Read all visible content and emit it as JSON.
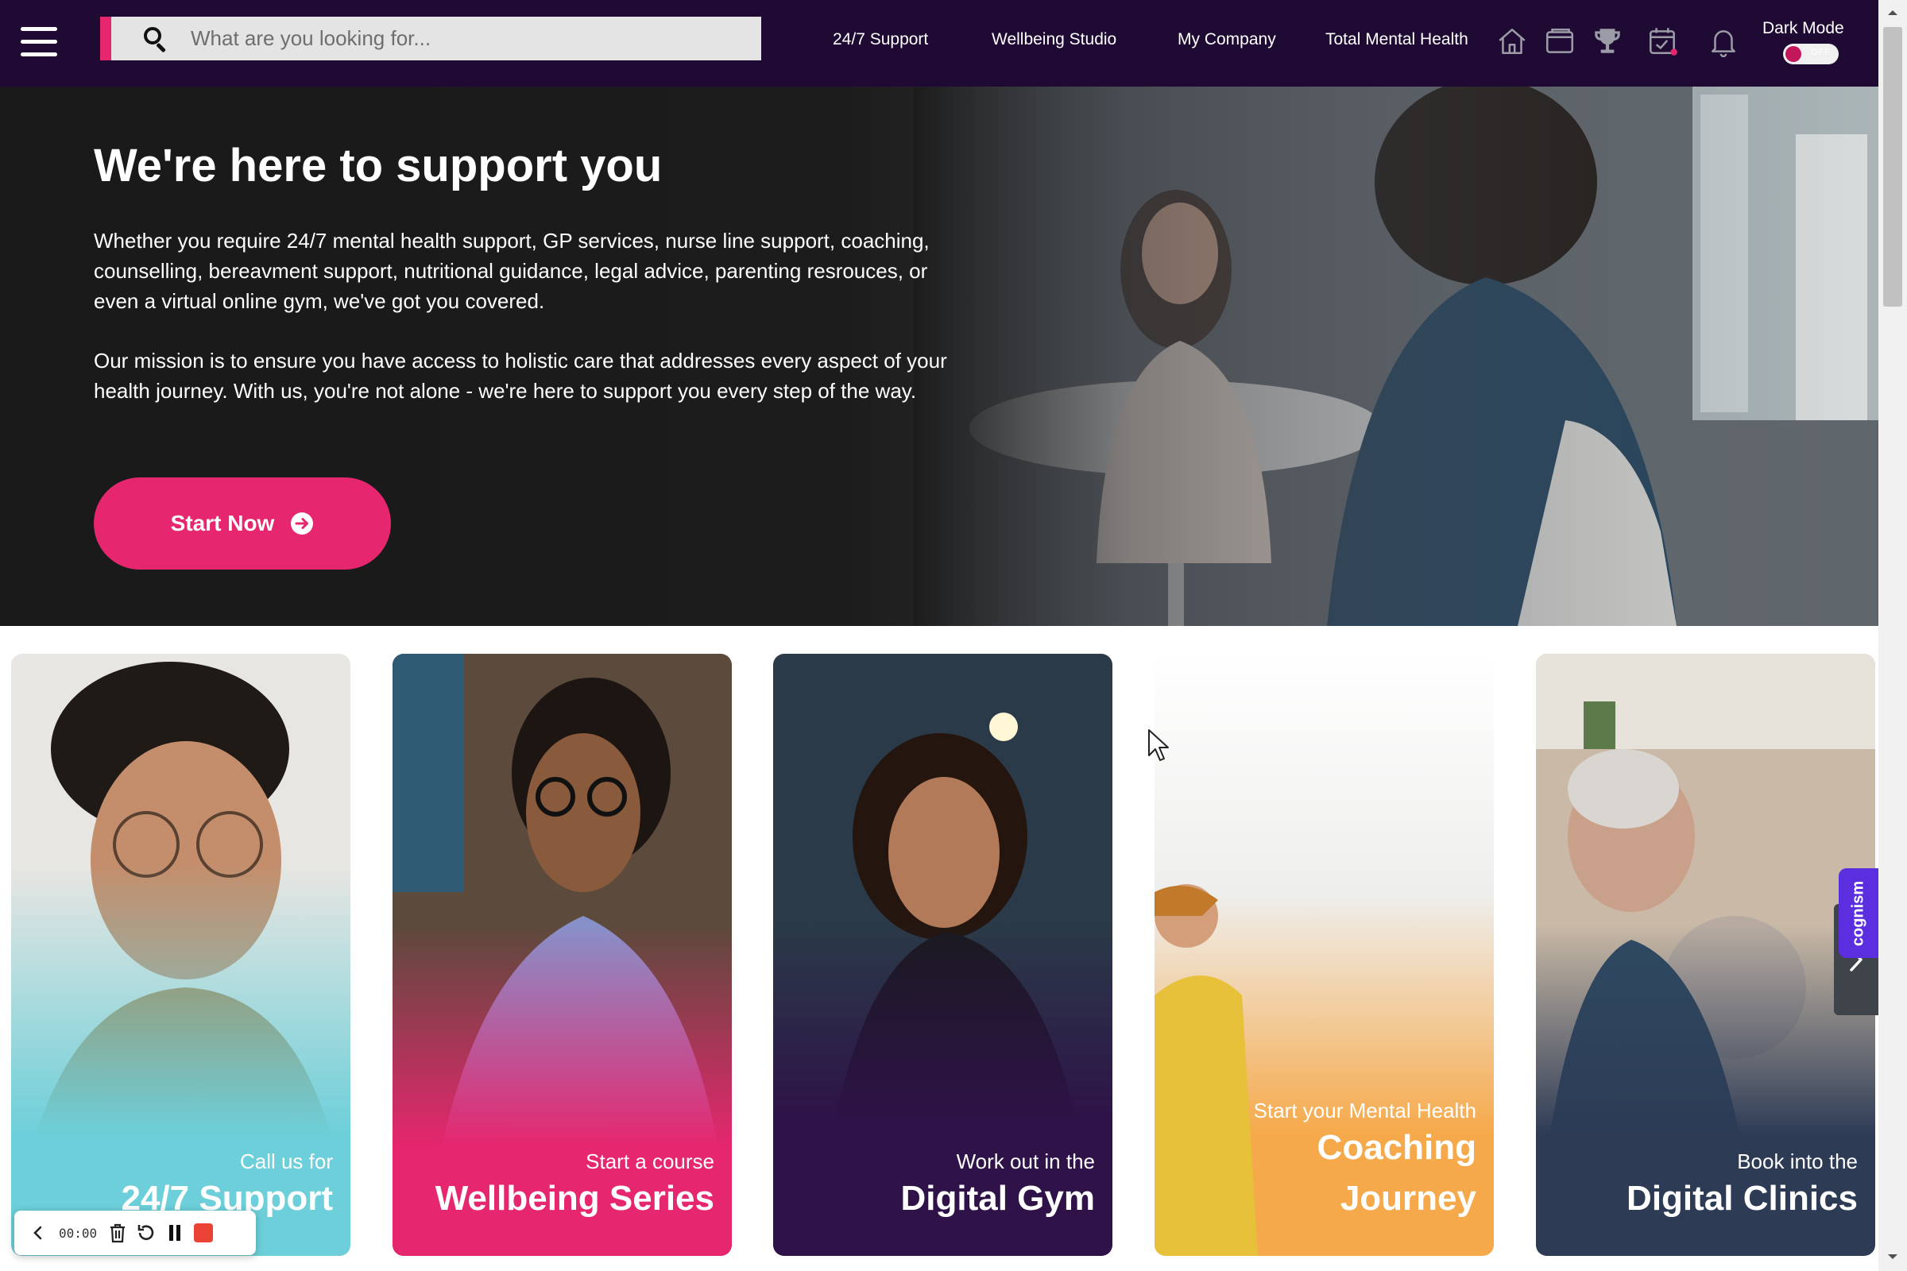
{
  "header": {
    "search_placeholder": "What are you looking for...",
    "nav_links": [
      "24/7 Support",
      "Wellbeing Studio",
      "My Company",
      "Total Mental Health"
    ],
    "icons": [
      "home-icon",
      "wallet-icon",
      "trophy-icon",
      "calendar-check-icon",
      "bell-icon"
    ],
    "dark_mode_label": "Dark Mode",
    "dark_mode_state": "OFF"
  },
  "hero": {
    "title": "We're here to support you",
    "paragraph1": "Whether you require 24/7 mental health support, GP services, nurse line support, coaching, counselling, bereavment support, nutritional guidance, legal advice, parenting resrouces, or even a virtual online gym, we've got you covered.",
    "paragraph2": "Our mission is to ensure you have access to holistic care that addresses every aspect of your health journey. With us, you're not alone - we're here to support you every step of the way.",
    "cta_label": "Start Now"
  },
  "cards": [
    {
      "subtitle": "Call us for",
      "title": "24/7 Support",
      "color": "#6ccfd9"
    },
    {
      "subtitle": "Start a course",
      "title": "Wellbeing Series",
      "color": "#e6266e"
    },
    {
      "subtitle": "Work out in the",
      "title": "Digital Gym",
      "color": "#2e1248"
    },
    {
      "subtitle": "Start your Mental Health",
      "title_line1": "Coaching",
      "title_line2": "Journey",
      "color": "#f6a94a"
    },
    {
      "subtitle": "Book into the",
      "title": "Digital Clinics",
      "color": "#2d3b55"
    }
  ],
  "side_tab": "cognism",
  "recorder": {
    "time": "00:00"
  },
  "colors": {
    "nav_bg": "#1f0a33",
    "accent": "#e6266e"
  }
}
